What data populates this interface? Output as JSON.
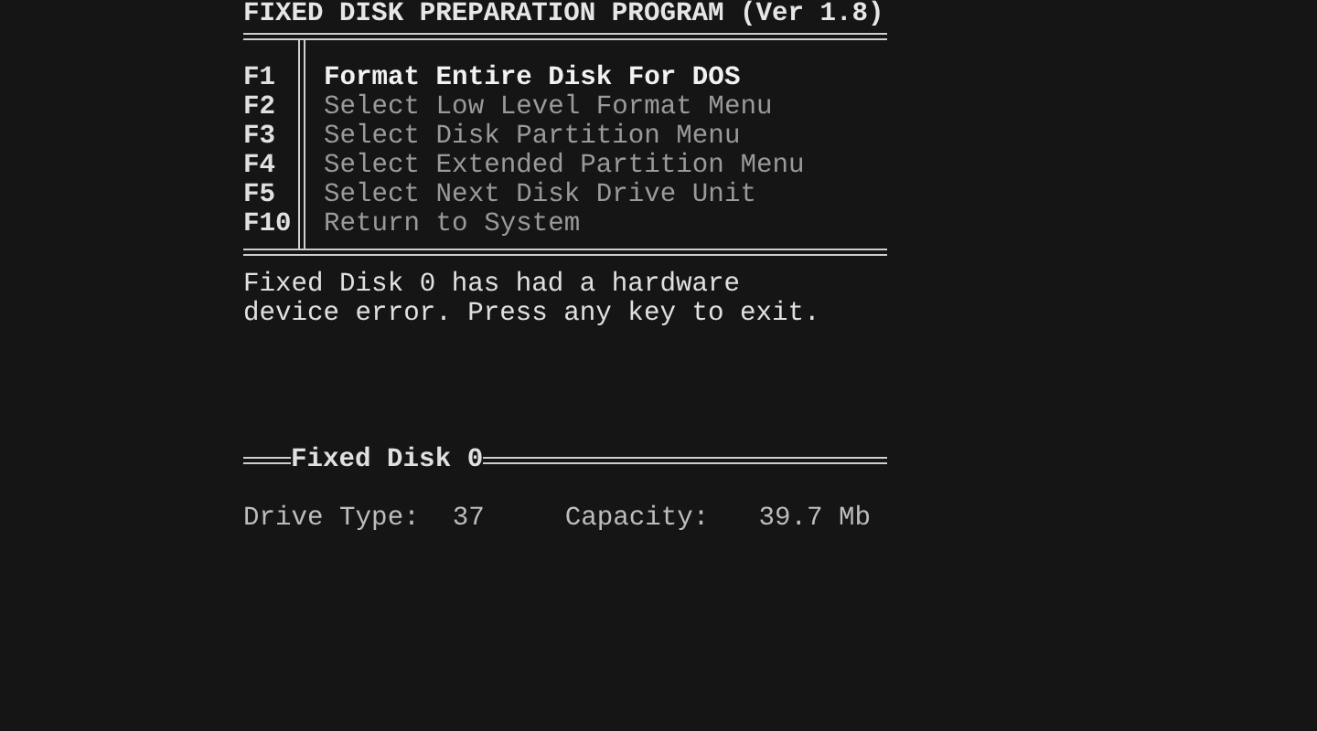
{
  "title": "FIXED DISK PREPARATION PROGRAM (Ver 1.8)",
  "menu": [
    {
      "key": "F1",
      "label": "Format Entire Disk For DOS",
      "selected": true
    },
    {
      "key": "F2",
      "label": "Select Low Level Format Menu",
      "selected": false
    },
    {
      "key": "F3",
      "label": "Select Disk Partition Menu",
      "selected": false
    },
    {
      "key": "F4",
      "label": "Select Extended Partition Menu",
      "selected": false
    },
    {
      "key": "F5",
      "label": "Select Next Disk Drive Unit",
      "selected": false
    },
    {
      "key": "F10",
      "label": "Return to System",
      "selected": false
    }
  ],
  "message": [
    "Fixed Disk 0 has had a hardware",
    "device error. Press any key to exit."
  ],
  "disk_panel": {
    "title": "Fixed Disk 0",
    "drive_type_label": "Drive Type:",
    "drive_type": "37",
    "capacity_label": "Capacity:",
    "capacity": "39.7 Mb"
  }
}
